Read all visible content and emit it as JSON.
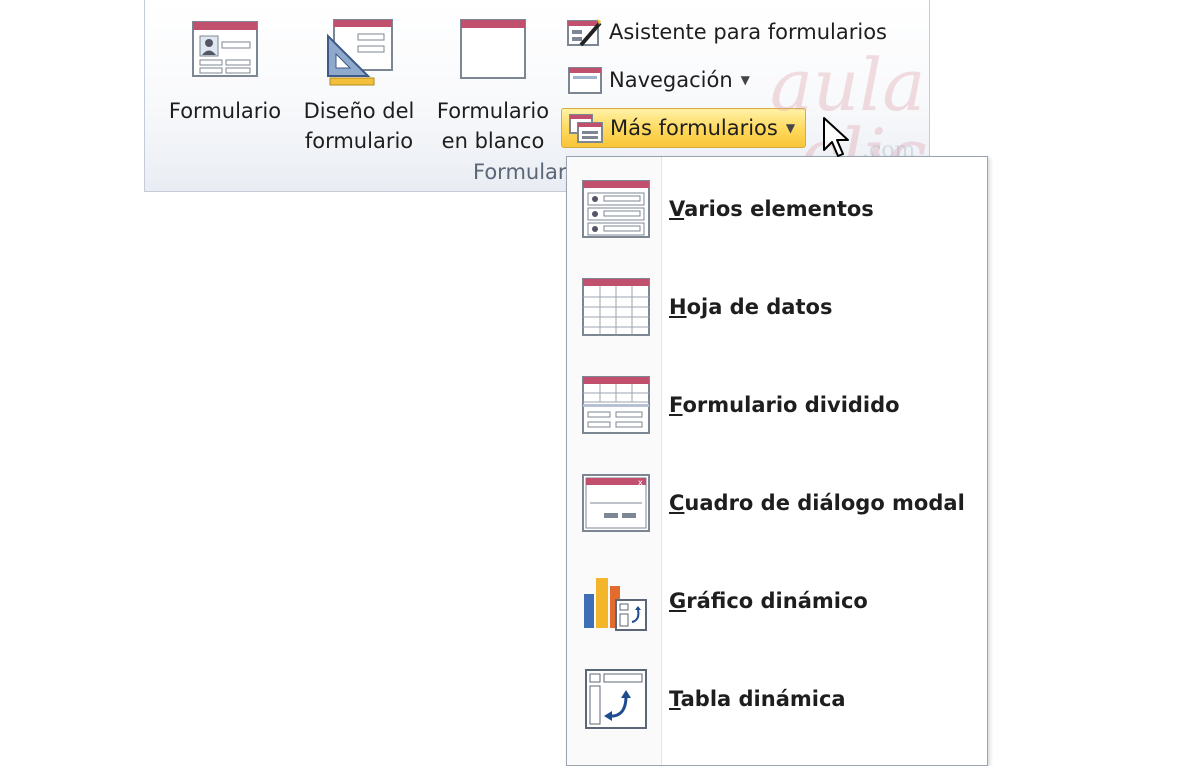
{
  "ribbon": {
    "group_label": "Formularios",
    "buttons": [
      {
        "label": "Formulario",
        "icon": "form-icon"
      },
      {
        "label": "Diseño del\nformulario",
        "icon": "form-design-icon"
      },
      {
        "label": "Formulario\nen blanco",
        "icon": "blank-form-icon"
      }
    ],
    "small_buttons": [
      {
        "label": "Asistente para formularios",
        "icon": "form-wizard-icon"
      },
      {
        "label": "Navegación",
        "icon": "navigation-icon"
      },
      {
        "label": "Más formularios",
        "icon": "more-forms-icon"
      }
    ]
  },
  "watermark": {
    "text": "aula",
    "text2": "clic",
    "domain": ".com"
  },
  "menu": {
    "items": [
      {
        "label": "Varios elementos",
        "icon": "multiple-items-icon"
      },
      {
        "label": "Hoja de datos",
        "icon": "datasheet-icon"
      },
      {
        "label": "Formulario dividido",
        "icon": "split-form-icon"
      },
      {
        "label": "Cuadro de diálogo modal",
        "icon": "modal-dialog-icon"
      },
      {
        "label": "Gráfico dinámico",
        "icon": "pivot-chart-icon"
      },
      {
        "label": "Tabla dinámica",
        "icon": "pivot-table-icon"
      }
    ]
  },
  "colors": {
    "accent": "#c0506e",
    "highlight": "#ffd85a",
    "border": "#9aa4b0"
  }
}
